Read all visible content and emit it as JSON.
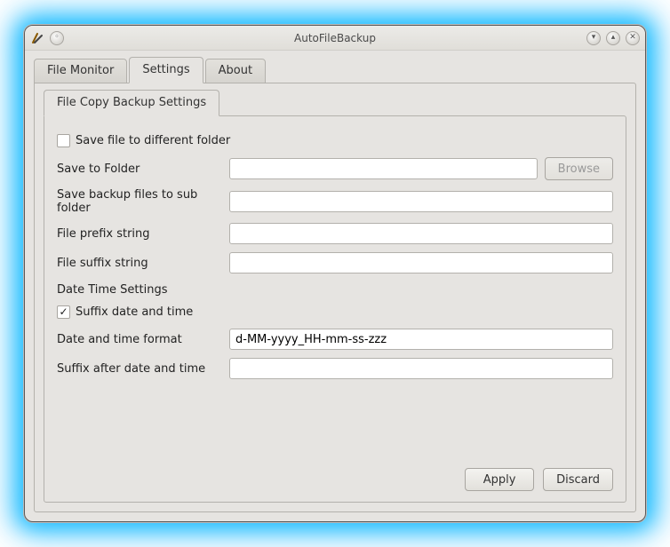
{
  "window": {
    "title": "AutoFileBackup"
  },
  "tabs": {
    "file_monitor": "File Monitor",
    "settings": "Settings",
    "about": "About"
  },
  "inner_tab": {
    "label": "File Copy Backup Settings"
  },
  "form": {
    "save_diff_folder_label": "Save file to different folder",
    "save_to_folder_label": "Save to Folder",
    "save_to_folder_value": "",
    "browse_label": "Browse",
    "save_sub_folder_label": "Save backup files to sub folder",
    "save_sub_folder_value": "",
    "file_prefix_label": "File prefix string",
    "file_prefix_value": "",
    "file_suffix_label": "File suffix string",
    "file_suffix_value": "",
    "date_time_section": "Date Time Settings",
    "suffix_date_time_label": "Suffix date and time",
    "date_format_label": "Date and time format",
    "date_format_value": "d-MM-yyyy_HH-mm-ss-zzz",
    "suffix_after_dt_label": "Suffix after date and time",
    "suffix_after_dt_value": ""
  },
  "buttons": {
    "apply": "Apply",
    "discard": "Discard"
  },
  "checkboxes": {
    "save_diff_folder_checked": false,
    "suffix_date_time_checked": true
  }
}
